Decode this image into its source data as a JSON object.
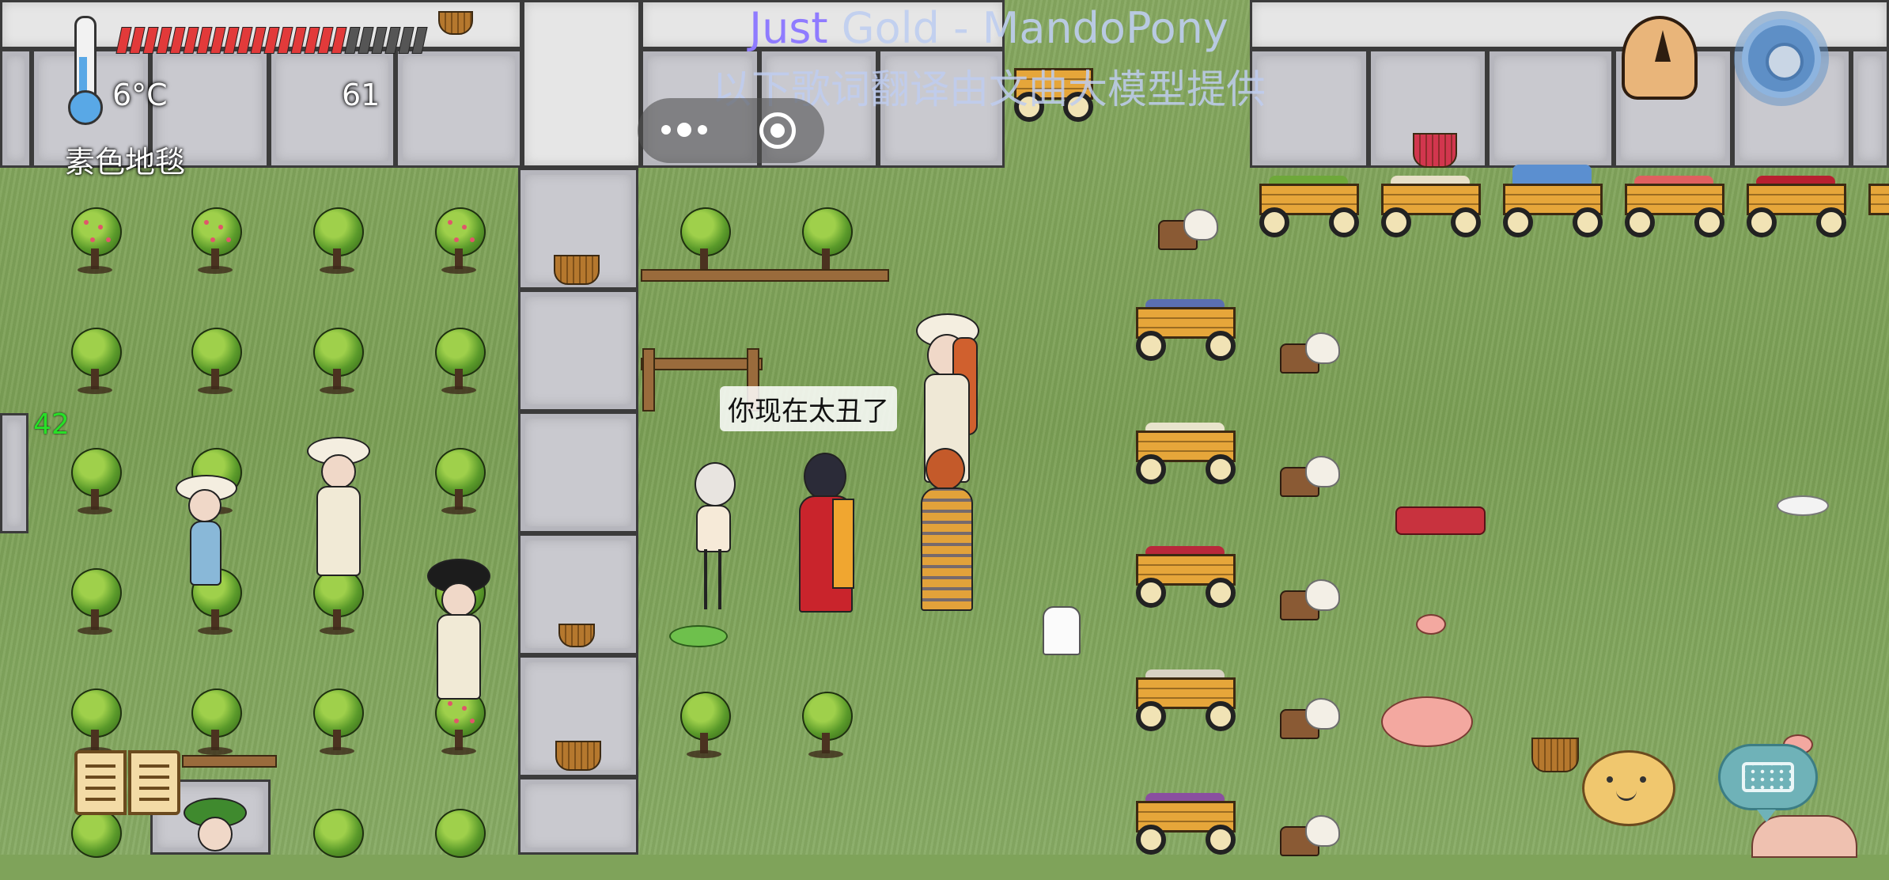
{
  "hud": {
    "temperature": "6°C",
    "yum_count": "61",
    "held_item": "素色地毯",
    "age": "42",
    "food_meter": {
      "filled": 17,
      "total": 23
    }
  },
  "music_overlay": {
    "title_highlight": "Just",
    "title_rest": " Gold - MandoPony",
    "translation_note": "以下歌词翻译由文曲大模型提供"
  },
  "speech_bubble": "你现在太丑了",
  "colors": {
    "food_full": "#e23a3a",
    "food_empty": "#555555",
    "age_text": "#27e027",
    "grass": "#7fa35a"
  },
  "icons": {
    "thermometer": "thermometer-icon",
    "compass": "compass-icon",
    "settings": "gear-icon",
    "book": "book-icon",
    "emote": "emote-face-icon",
    "keyboard": "keyboard-icon",
    "more": "more-dots-icon",
    "record": "record-icon"
  }
}
